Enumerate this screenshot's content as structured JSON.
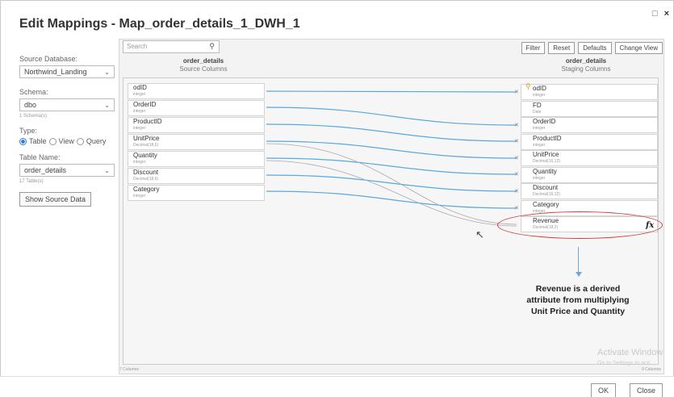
{
  "dialog": {
    "title": "Edit Mappings - Map_order_details_1_DWH_1",
    "min_glyph": "□",
    "close_glyph": "×"
  },
  "left": {
    "source_db_label": "Source Database:",
    "source_db_value": "Northwind_Landing",
    "schema_label": "Schema:",
    "schema_value": "dbo",
    "schema_count": "1 Schema(s)",
    "type_label": "Type:",
    "type_options": [
      "Table",
      "View",
      "Query"
    ],
    "table_name_label": "Table Name:",
    "table_name_value": "order_details",
    "table_count": "17 Table(s)",
    "show_source_button": "Show Source Data"
  },
  "search": {
    "placeholder": "Search"
  },
  "toolbar": {
    "filter": "Filter",
    "reset": "Reset",
    "defaults": "Defaults",
    "change_view": "Change View"
  },
  "source": {
    "title": "order_details",
    "subtitle": "Source Columns",
    "fields": [
      {
        "name": "odID",
        "type": "integer"
      },
      {
        "name": "OrderID",
        "type": "integer"
      },
      {
        "name": "ProductID",
        "type": "integer"
      },
      {
        "name": "UnitPrice",
        "type": "Decimal(18,6)"
      },
      {
        "name": "Quantity",
        "type": "integer"
      },
      {
        "name": "Discount",
        "type": "Decimal(18,6)"
      },
      {
        "name": "Category",
        "type": "integer"
      }
    ],
    "col_count": "7 Columns"
  },
  "target": {
    "title": "order_details",
    "subtitle": "Staging Columns",
    "fields": [
      {
        "name": "odID",
        "type": "integer"
      },
      {
        "name": "FD",
        "type": "Date"
      },
      {
        "name": "OrderID",
        "type": "integer"
      },
      {
        "name": "ProductID",
        "type": "integer"
      },
      {
        "name": "UnitPrice",
        "type": "Decimal(16,12)"
      },
      {
        "name": "Quantity",
        "type": "integer"
      },
      {
        "name": "Discount",
        "type": "Decimal(16,12)"
      },
      {
        "name": "Category",
        "type": "integer"
      },
      {
        "name": "Revenue",
        "type": "Decimal(18,2)"
      }
    ],
    "col_count": "9 Columns",
    "fx_label": "fx"
  },
  "annotation": {
    "note": "Revenue is a derived attribute from multiplying Unit Price and Quantity"
  },
  "watermark": {
    "line1": "Activate Window",
    "line2": "Go to Settings to acti"
  },
  "footer": {
    "ok": "OK",
    "close": "Close"
  },
  "colors": {
    "mapping_line": "#5aa7de",
    "highlight": "#d63b3b",
    "accent": "#2b7cd3"
  }
}
